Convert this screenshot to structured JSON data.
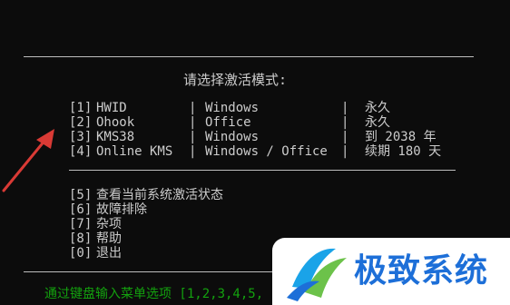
{
  "prompt": "请选择激活模式:",
  "activation_options": [
    {
      "key": "[1]",
      "name": "HWID",
      "sep": "|",
      "target": "Windows",
      "sep2": "|",
      "duration": "永久"
    },
    {
      "key": "[2]",
      "name": "Ohook",
      "sep": "|",
      "target": "Office",
      "sep2": "|",
      "duration": "永久"
    },
    {
      "key": "[3]",
      "name": "KMS38",
      "sep": "|",
      "target": "Windows",
      "sep2": "|",
      "duration": "到 2038 年"
    },
    {
      "key": "[4]",
      "name": "Online KMS",
      "sep": "|",
      "target": "Windows / Office",
      "sep2": "|",
      "duration": "续期 180 天"
    }
  ],
  "misc_options": [
    {
      "key": "[5]",
      "label": "查看当前系统激活状态"
    },
    {
      "key": "[6]",
      "label": "故障排除"
    },
    {
      "key": "[7]",
      "label": "杂项"
    },
    {
      "key": "[8]",
      "label": "帮助"
    },
    {
      "key": "[0]",
      "label": "退出"
    }
  ],
  "footer": "通过键盘输入菜单选项 [1,2,3,4,5,",
  "watermark": {
    "text": "极致系统"
  },
  "colors": {
    "background": "#0c0c0c",
    "text": "#cccccc",
    "footer": "#13a10e",
    "arrow": "#d93a35",
    "watermark_text": "#1d6fd8"
  }
}
